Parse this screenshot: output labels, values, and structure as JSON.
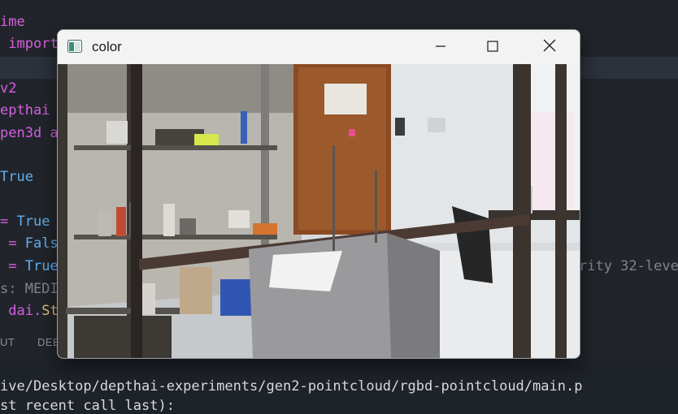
{
  "editor": {
    "lines": [
      {
        "t1": "ime",
        "t2": ""
      },
      {
        "t1": " import",
        "t2": ""
      },
      {
        "t1": "v2",
        "t2": ""
      },
      {
        "t1": "epthai",
        "t2": ""
      },
      {
        "t1": "pen3d a",
        "t2": ""
      },
      {
        "t1": "True",
        "t2": ""
      },
      {
        "t1": "= ",
        "t2": "True"
      },
      {
        "t1": " = ",
        "t2": "Fals"
      },
      {
        "t1": " = ",
        "t2": "True"
      },
      {
        "t1": "s: MEDI",
        "t2": ""
      },
      {
        "t1": " dai.",
        "t2": "St"
      }
    ],
    "trailing_comment": "rity 32-leve"
  },
  "panel": {
    "tabs": [
      "UT",
      "DEB"
    ]
  },
  "terminal": {
    "line1": "ive/Desktop/depthai-experiments/gen2-pointcloud/rgbd-pointcloud/main.p",
    "line2": "st recent call last):"
  },
  "window": {
    "title": "color",
    "icons": {
      "app": "app-window-icon",
      "minimize": "minimize-icon",
      "maximize": "maximize-icon",
      "close": "close-icon"
    }
  },
  "colors": {
    "editor_bg": "#21252b",
    "keyword": "#d55fde",
    "bool": "#61afef",
    "titlebar": "#f3f3f3"
  }
}
